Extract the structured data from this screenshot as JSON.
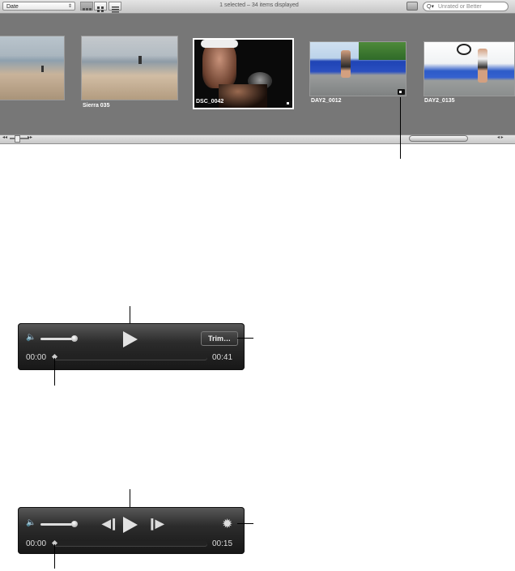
{
  "toolbar": {
    "sort_value": "Date",
    "status_text": "1 selected – 34 items displayed",
    "filter_placeholder": "Unrated or Better",
    "view_modes": [
      "filmstrip-view",
      "grid-view",
      "list-view"
    ]
  },
  "browser": {
    "items": [
      {
        "label": "",
        "kind": "beach"
      },
      {
        "label": "Sierra 035",
        "kind": "beach"
      },
      {
        "label": "DSC_0042",
        "kind": "video",
        "selected": true
      },
      {
        "label": "DAY2_0012",
        "kind": "video"
      },
      {
        "label": "DAY2_0135",
        "kind": "photo"
      }
    ]
  },
  "player1": {
    "play_icon": "play-icon",
    "trim_label": "Trim…",
    "time_start": "00:00",
    "time_end": "00:41",
    "volume_level": 0.75
  },
  "player2": {
    "time_start": "00:00",
    "time_end": "00:15",
    "volume_level": 0.75,
    "gear_icon": "gear-icon"
  },
  "colors": {
    "browser_bg": "#777777",
    "player_bg": "#1e1e1e",
    "selection_border": "#ffffff"
  }
}
